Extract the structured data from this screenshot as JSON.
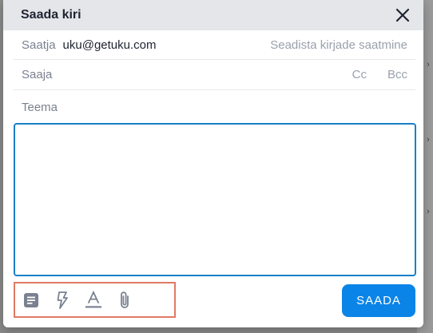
{
  "dialog": {
    "title": "Saada kiri",
    "close_icon": "close-icon"
  },
  "from": {
    "label": "Saatja",
    "value": "uku@getuku.com",
    "settings_link": "Seadista kirjade saatmine"
  },
  "to": {
    "label": "Saaja",
    "cc": "Cc",
    "bcc": "Bcc"
  },
  "subject": {
    "placeholder": "Teema"
  },
  "toolbar": {
    "icons": [
      "template-icon",
      "lightning-icon",
      "text-format-icon",
      "attachment-icon"
    ]
  },
  "send": {
    "label": "SAADA"
  },
  "colors": {
    "accent": "#0b84e8",
    "focus_border": "#1a7fc7",
    "highlight_border": "#e07a66",
    "header_bg": "#e4e6ea",
    "icon": "#7a8190"
  }
}
